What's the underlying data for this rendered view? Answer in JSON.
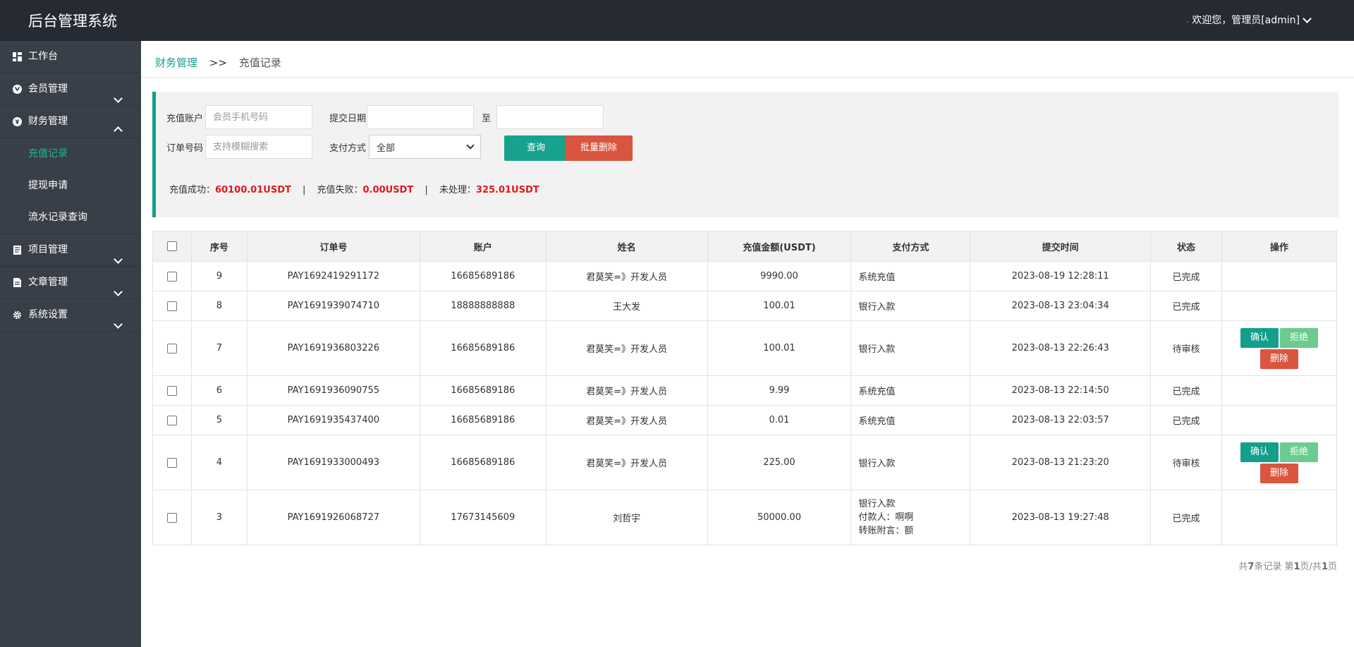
{
  "app": {
    "title": "后台管理系统",
    "user_dot": ".",
    "user_label": "欢迎您，管理员[admin]"
  },
  "sidebar": {
    "items": [
      {
        "label": "工作台",
        "icon": "dashboard-icon"
      },
      {
        "label": "会员管理",
        "icon": "member-icon"
      },
      {
        "label": "财务管理",
        "icon": "finance-icon"
      },
      {
        "label": "项目管理",
        "icon": "project-icon"
      },
      {
        "label": "文章管理",
        "icon": "article-icon"
      },
      {
        "label": "系统设置",
        "icon": "gear-icon"
      }
    ],
    "finance_sub": [
      {
        "label": "充值记录",
        "active": true
      },
      {
        "label": "提现申请"
      },
      {
        "label": "流水记录查询"
      }
    ]
  },
  "breadcrumb": {
    "parent": "财务管理",
    "sep": ">>",
    "current": "充值记录"
  },
  "filters": {
    "account_label": "充值账户",
    "account_placeholder": "会员手机号码",
    "account_value": "",
    "date_label": "提交日期",
    "date_to": "至",
    "date_from_value": "",
    "date_to_value": "",
    "order_label": "订单号码",
    "order_placeholder": "支持模糊搜索",
    "order_value": "",
    "pay_label": "支付方式",
    "pay_selected": "全部",
    "query_label": "查询",
    "batch_delete_label": "批量删除"
  },
  "stats": {
    "success_label": "充值成功：",
    "success_value": "60100.01USDT",
    "fail_label": "充值失败：",
    "fail_value": "0.00USDT",
    "pending_label": "未处理：",
    "pending_value": "325.01USDT",
    "sep": "|"
  },
  "table": {
    "headers": [
      "序号",
      "订单号",
      "账户",
      "姓名",
      "充值金额(USDT)",
      "支付方式",
      "提交时间",
      "状态",
      "操作"
    ],
    "rows": [
      {
        "no": "9",
        "order": "PAY1692419291172",
        "account": "16685689186",
        "name": "君莫笑=》开发人员",
        "amount": "9990.00",
        "pay": "系统充值",
        "time": "2023-08-19 12:28:11",
        "status": "已完成"
      },
      {
        "no": "8",
        "order": "PAY1691939074710",
        "account": "18888888888",
        "name": "王大发",
        "amount": "100.01",
        "pay": "银行入款",
        "time": "2023-08-13 23:04:34",
        "status": "已完成"
      },
      {
        "no": "7",
        "order": "PAY1691936803226",
        "account": "16685689186",
        "name": "君莫笑=》开发人员",
        "amount": "100.01",
        "pay": "银行入款",
        "time": "2023-08-13 22:26:43",
        "status": "待审核"
      },
      {
        "no": "6",
        "order": "PAY1691936090755",
        "account": "16685689186",
        "name": "君莫笑=》开发人员",
        "amount": "9.99",
        "pay": "系统充值",
        "time": "2023-08-13 22:14:50",
        "status": "已完成"
      },
      {
        "no": "5",
        "order": "PAY1691935437400",
        "account": "16685689186",
        "name": "君莫笑=》开发人员",
        "amount": "0.01",
        "pay": "系统充值",
        "time": "2023-08-13 22:03:57",
        "status": "已完成"
      },
      {
        "no": "4",
        "order": "PAY1691933000493",
        "account": "16685689186",
        "name": "君莫笑=》开发人员",
        "amount": "225.00",
        "pay": "银行入款",
        "time": "2023-08-13 21:23:20",
        "status": "待审核"
      },
      {
        "no": "3",
        "order": "PAY1691926068727",
        "account": "17673145609",
        "name": "刘哲宇",
        "amount": "50000.00",
        "pay": "银行入款",
        "pay_line2": "付款人：啊啊",
        "pay_line3": "转账附言：额",
        "time": "2023-08-13 19:27:48",
        "status": "已完成"
      }
    ],
    "actions": {
      "confirm": "确认",
      "reject": "拒绝",
      "delete": "删除"
    }
  },
  "pager": {
    "prefix": "共",
    "total": "7",
    "mid": "条记录 第",
    "page": "1",
    "sep": "页/共",
    "pages": "1",
    "suffix": "页"
  },
  "colors": {
    "topbar": "#262b33",
    "sidebar": "#393f48",
    "accent": "#139f8b",
    "danger": "#d9553f",
    "stat_value": "#e1171d"
  }
}
